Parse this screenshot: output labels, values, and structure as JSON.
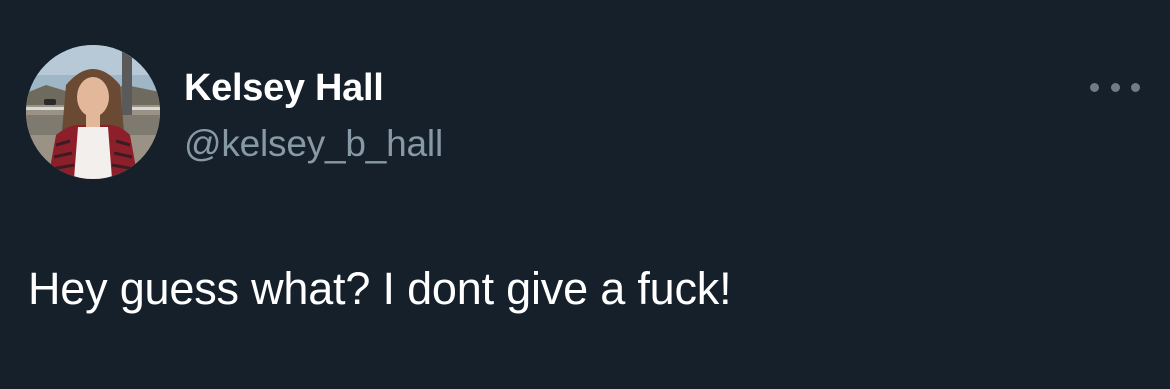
{
  "tweet": {
    "author": {
      "display_name": "Kelsey Hall",
      "handle": "@kelsey_b_hall",
      "avatar_icon": "profile-photo"
    },
    "more_icon": "more-options-icon",
    "text": "Hey guess what? I dont give a fuck!"
  },
  "colors": {
    "background": "#15202b",
    "name": "#ffffff",
    "handle": "#8899a6",
    "body_text": "#ffffff",
    "more_dots": "#6e7c88"
  }
}
